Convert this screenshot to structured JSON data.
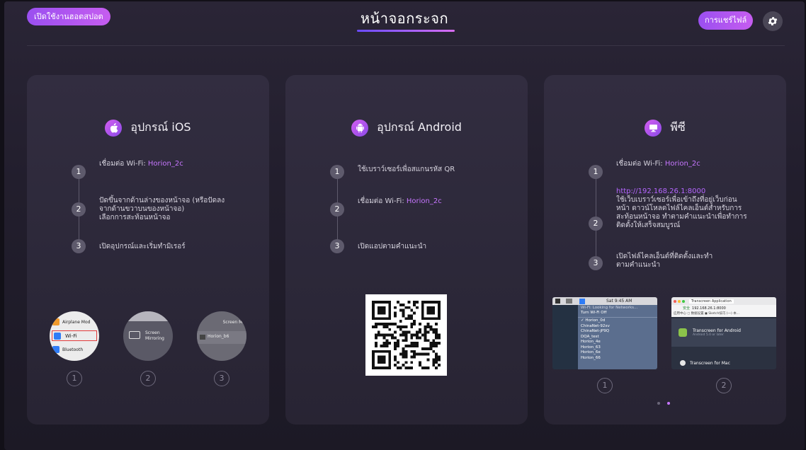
{
  "header": {
    "hotspot_label": "เปิดใช้งานฮอตสปอต",
    "title": "หน้าจอกระจก",
    "file_share_label": "การแชร์ไฟล์",
    "settings_icon": "gear-icon"
  },
  "cards": {
    "ios": {
      "title": "อุปกรณ์ iOS",
      "icon": "apple-icon",
      "steps": [
        {
          "num": "1",
          "prefix": "เชื่อมต่อ   Wi-Fi: ",
          "highlight": "Horion_2c"
        },
        {
          "num": "2",
          "lines": [
            "ปัดขึ้นจากด้านล่างของหน้าจอ (หรือปัดลง",
            "จากด้านขวาบนของหน้าจอ)",
            "เลือกการสะท้อนหน้าจอ"
          ]
        },
        {
          "num": "3",
          "text": "เปิดอุปกรณ์และเริ่มทำมิเรอร์"
        }
      ],
      "thumbs": {
        "t1": {
          "row1": "Airplane Mod",
          "row2": "Wi-Fi",
          "row3": "Bluetooth"
        },
        "t2": {
          "line1": "Screen",
          "line2": "Mirroring"
        },
        "t3": {
          "header": "Screen Mi",
          "device": "Horion_b6"
        }
      },
      "thumb_nums": [
        "1",
        "2",
        "3"
      ]
    },
    "android": {
      "title": "อุปกรณ์ Android",
      "icon": "android-icon",
      "steps": [
        {
          "num": "1",
          "text": "ใช้เบราว์เซอร์เพื่อสแกนรหัส QR"
        },
        {
          "num": "2",
          "prefix": "เชื่อมต่อ   Wi-Fi: ",
          "highlight": "Horion_2c"
        },
        {
          "num": "3",
          "text": "เปิดแอปตามคำแนะนำ"
        }
      ]
    },
    "pc": {
      "title": "พีซี",
      "icon": "monitor-icon",
      "steps": [
        {
          "num": "1",
          "prefix": "เชื่อมต่อ   Wi-Fi: ",
          "highlight": "Horion_2c"
        },
        {
          "num": "2",
          "url": "http://192.168.26.1:8000",
          "lines": [
            "ใช้เว็บเบราว์เซอร์เพื่อเข้าถึงที่อยู่เว็บก่อน",
            "หน้า ดาวน์โหลดไฟล์ไคลเอ็นต์สำหรับการ",
            "สะท้อนหน้าจอ ทำตามคำแนะนำเพื่อทำการ",
            "ติดตั้งให้เสร็จสมบูรณ์"
          ]
        },
        {
          "num": "3",
          "lines": [
            "เปิดไฟล์ไคลเอ็นต์ที่ติดตั้งและทำ",
            "ตามคำแนะนำ"
          ]
        }
      ],
      "shot1": {
        "menubar_time": "Sat 9:45 AM",
        "looking": "Wi-Fi: Looking for Networks...",
        "turn_off": "Turn Wi-Fi Off",
        "networks": [
          "✓ Horion_0d",
          "ChinaNet-92xv",
          "ChinaNet-jP9Q",
          "DQA_test",
          "Horion_4e",
          "Horion_63",
          "Horion_6e",
          "Horion_66"
        ]
      },
      "shot2": {
        "tab": "Transcreen Application",
        "address": "192.168.26.1:8000",
        "address_prefix": "安全",
        "bookmarks": "应用中心  ◻ 数据设置  ◼ Sketch技巧 (一) 本...",
        "android_row": "Transcreen for Android",
        "android_sub": "Android 5.0 or later",
        "mac_row": "Transcreen for Mac"
      },
      "shot_nums": [
        "1",
        "2"
      ]
    }
  },
  "colors": {
    "accent": "#c776ff",
    "accent_gradient_start": "#9a4ff0",
    "accent_gradient_end": "#c65df0",
    "card_bg": "#2e2a3b",
    "page_bg": "#221e2d"
  }
}
